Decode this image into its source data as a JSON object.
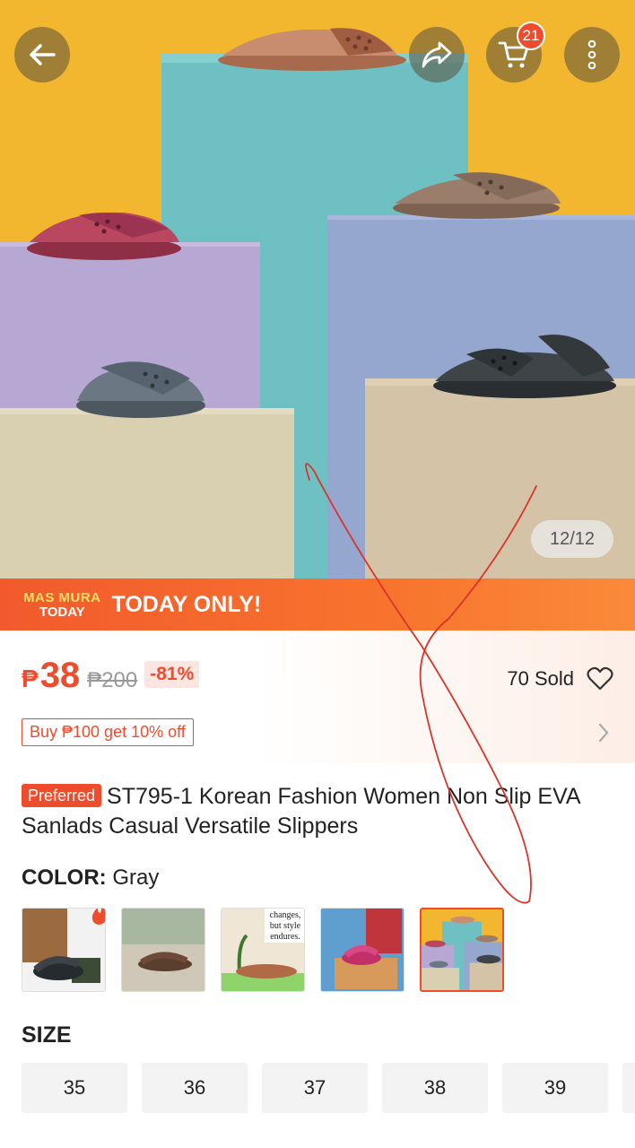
{
  "header": {
    "cart_count": "21",
    "image_counter": "12/12"
  },
  "promo": {
    "logo_line1": "MAS MURA",
    "logo_line2": "TODAY",
    "text": "TODAY ONLY!"
  },
  "price": {
    "currency": "₱",
    "current": "38",
    "original": "₱200",
    "discount": "-81%",
    "sold": "70 Sold",
    "voucher": "Buy ₱100 get 10% off"
  },
  "product": {
    "badge": "Preferred",
    "title": "ST795-1 Korean Fashion Women Non Slip EVA Sanlads Casual Versatile Slippers"
  },
  "color": {
    "label": "COLOR:",
    "selected": "Gray",
    "swatch3_text": "changes, but style endures."
  },
  "size": {
    "label": "SIZE",
    "options": [
      "35",
      "36",
      "37",
      "38",
      "39"
    ]
  },
  "colors": {
    "accent": "#ee4d2d",
    "hero_bg": "#f3b62f"
  }
}
